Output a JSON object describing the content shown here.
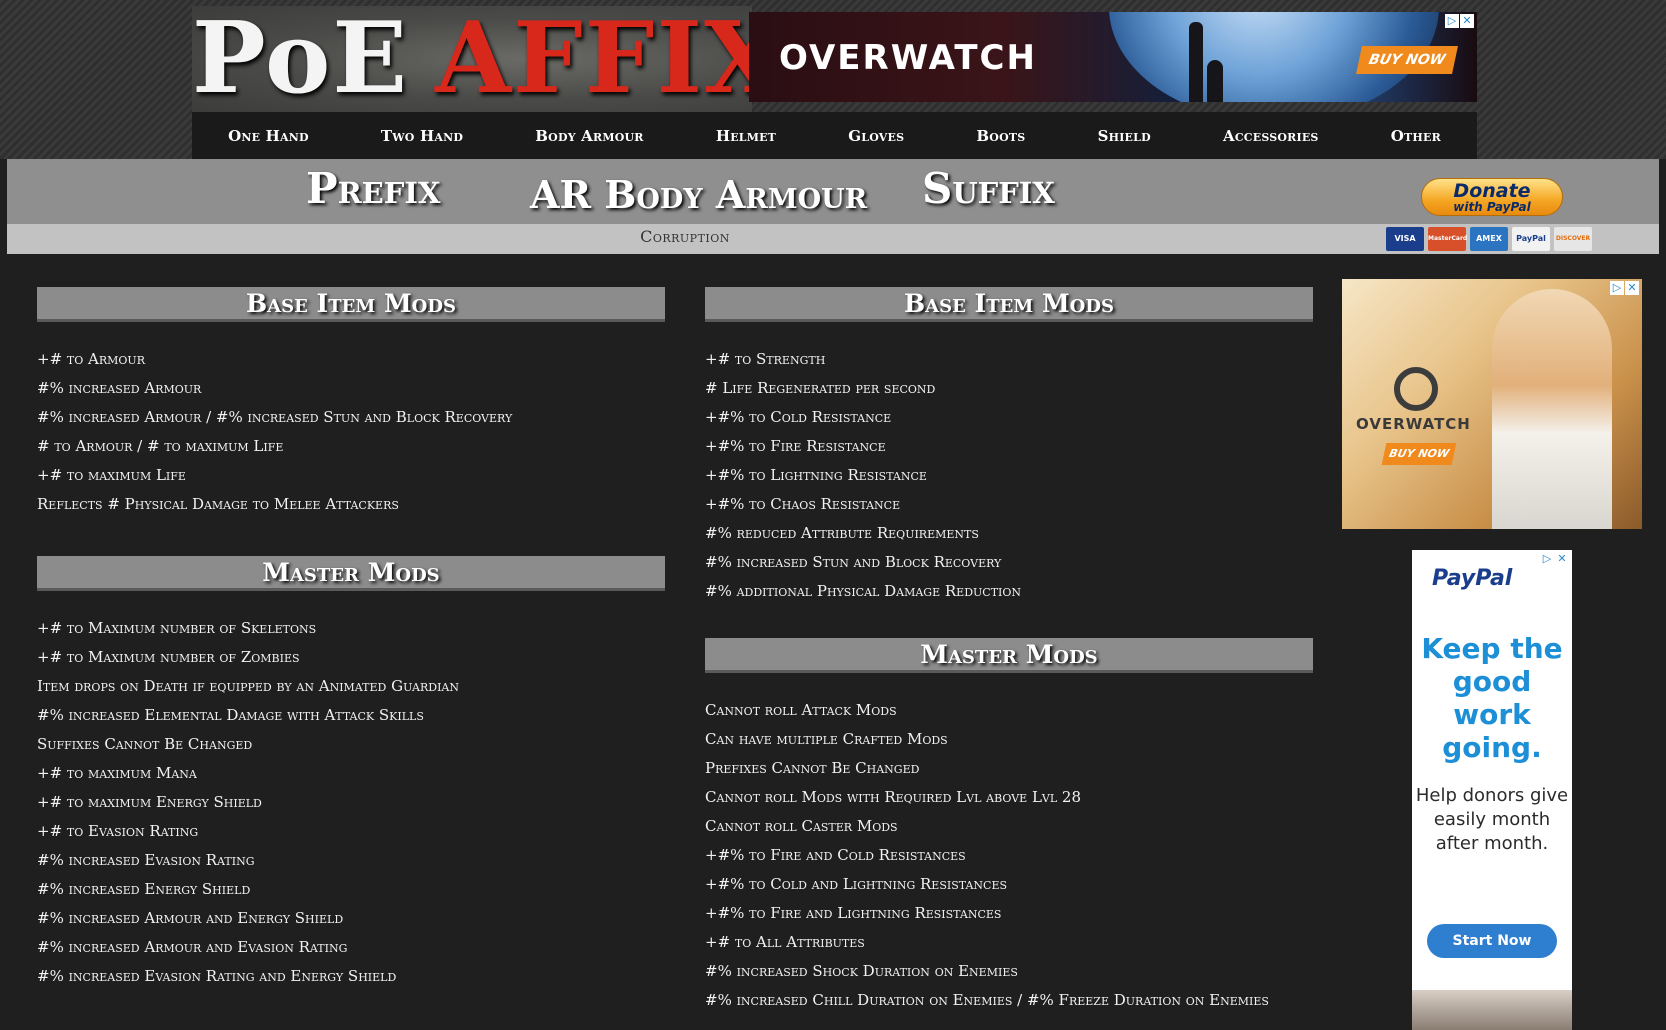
{
  "header": {
    "logo_poe": "PoE",
    "logo_affix": "AFFIX",
    "ad_banner": {
      "brand": "OVERWATCH",
      "cta": "BUY NOW",
      "icons": [
        "adchoices-icon",
        "close-icon"
      ]
    }
  },
  "nav": {
    "items": [
      "One Hand",
      "Two Hand",
      "Body Armour",
      "Helmet",
      "Gloves",
      "Boots",
      "Shield",
      "Accessories",
      "Other"
    ]
  },
  "titlebar": {
    "prefix": "Prefix",
    "item_name": "AR Body Armour",
    "suffix": "Suffix",
    "corruption": "Corruption"
  },
  "donate": {
    "line1": "Donate",
    "line2": "with PayPal",
    "cards": [
      "VISA",
      "MasterCard",
      "AMEX",
      "PayPal",
      "DISCOVER"
    ]
  },
  "prefix": {
    "base_title": "Base Item Mods",
    "base_mods": [
      "+# to Armour",
      "#% increased Armour",
      "#% increased Armour / #% increased Stun and Block Recovery",
      "# to Armour / # to maximum Life",
      "+# to maximum Life",
      "Reflects # Physical Damage to Melee Attackers"
    ],
    "master_title": "Master Mods",
    "master_mods": [
      "+# to Maximum number of Skeletons",
      "+# to Maximum number of Zombies",
      "Item drops on Death if equipped by an Animated Guardian",
      "#% increased Elemental Damage with Attack Skills",
      "Suffixes Cannot Be Changed",
      "+# to maximum Mana",
      "+# to maximum Energy Shield",
      "+# to Evasion Rating",
      "#% increased Evasion Rating",
      "#% increased Energy Shield",
      "#% increased Armour and Energy Shield",
      "#% increased Armour and Evasion Rating",
      "#% increased Evasion Rating and Energy Shield"
    ]
  },
  "suffix": {
    "base_title": "Base Item Mods",
    "base_mods": [
      "+# to Strength",
      "# Life Regenerated per second",
      "+#% to Cold Resistance",
      "+#% to Fire Resistance",
      "+#% to Lightning Resistance",
      "+#% to Chaos Resistance",
      "#% reduced Attribute Requirements",
      "#% increased Stun and Block Recovery",
      "#% additional Physical Damage Reduction"
    ],
    "master_title": "Master Mods",
    "master_mods": [
      "Cannot roll Attack Mods",
      "Can have multiple Crafted Mods",
      "Prefixes Cannot Be Changed",
      "Cannot roll Mods with Required Lvl above Lvl 28",
      "Cannot roll Caster Mods",
      "+#% to Fire and Cold Resistances",
      "+#% to Cold and Lightning Resistances",
      "+#% to Fire and Lightning Resistances",
      "+# to All Attributes",
      "#% increased Shock Duration on Enemies",
      "#% increased Chill Duration on Enemies / #% Freeze Duration on Enemies"
    ]
  },
  "side_ads": {
    "overwatch": {
      "brand": "OVERWATCH",
      "cta": "BUY NOW"
    },
    "paypal": {
      "logo": "PayPal",
      "headline": "Keep the good work going.",
      "body": "Help donors give easily month after month.",
      "cta": "Start Now"
    }
  }
}
